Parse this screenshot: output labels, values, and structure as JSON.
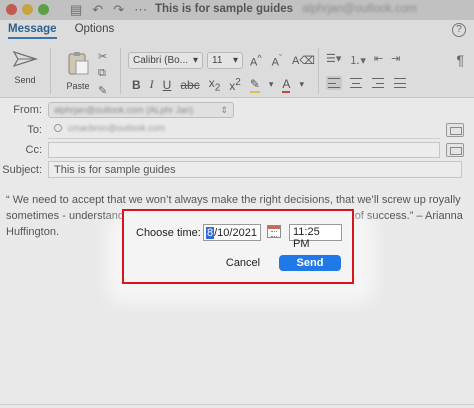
{
  "window": {
    "title": "This is for sample guides",
    "account": "alphrjan@outlook.com"
  },
  "ribbon": {
    "tabs": [
      {
        "label": "Message",
        "active": true
      },
      {
        "label": "Options",
        "active": false
      }
    ],
    "send_label": "Send",
    "paste_label": "Paste",
    "font_name": "Calibri (Bo...",
    "font_size": "11"
  },
  "compose": {
    "from_label": "From:",
    "from_value": "alphrjan@outlook.com (ALphr Jan)",
    "to_label": "To:",
    "to_value": "cmacbron@outlook.com",
    "cc_label": "Cc:",
    "subject_label": "Subject:",
    "subject_value": "This is for sample guides",
    "body_line1": "“ We need to accept that we won’t always make the right decisions, that we’ll screw up royally",
    "body_line2_start": "sometimes - understandin",
    "body_line2_end": "of success.” – Arianna",
    "body_line3": "Huffington."
  },
  "dialog": {
    "choose_time_label": "Choose time:",
    "date_month": "8",
    "date_rest": "/10/2021",
    "time_value": "11:25 PM",
    "cancel_label": "Cancel",
    "send_label": "Send"
  },
  "colors": {
    "accent": "#1f7ae8",
    "highlight_border": "#d9141d",
    "active_tab": "#3a74a8"
  }
}
